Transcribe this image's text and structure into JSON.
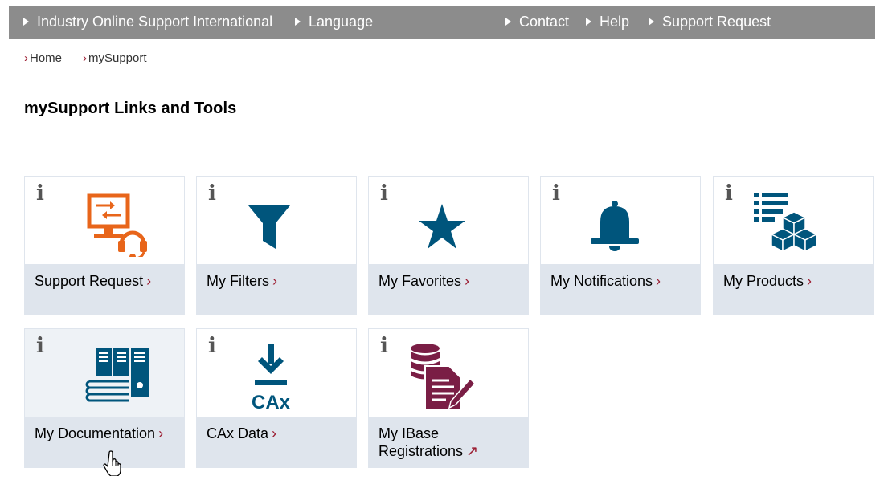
{
  "topbar": {
    "left_links": [
      "Industry Online Support International",
      "Language"
    ],
    "right_links": [
      "Contact",
      "Help",
      "Support Request"
    ],
    "background": "#8c8c8c"
  },
  "breadcrumb": [
    "Home",
    "mySupport"
  ],
  "page_title": "mySupport Links and Tools",
  "tiles": [
    {
      "label": "Support Request",
      "arrow": "›",
      "icon": "monitor-headset-icon",
      "info": "i"
    },
    {
      "label": "My Filters",
      "arrow": "›",
      "icon": "filter-icon",
      "info": "i"
    },
    {
      "label": "My Favorites",
      "arrow": "›",
      "icon": "star-icon",
      "info": "i"
    },
    {
      "label": "My Notifications",
      "arrow": "›",
      "icon": "bell-icon",
      "info": "i"
    },
    {
      "label": "My Products",
      "arrow": "›",
      "icon": "product-cubes-icon",
      "info": "i"
    },
    {
      "label": "My Documentation",
      "arrow": "›",
      "icon": "documentation-binders-icon",
      "info": "i"
    },
    {
      "label": "CAx Data",
      "arrow": "›",
      "icon": "cax-download-icon",
      "info": "i",
      "icon_text": "CAx"
    },
    {
      "label": "My IBase Registrations",
      "arrow": "↗",
      "icon": "ibase-database-document-icon",
      "info": "i"
    }
  ],
  "colors": {
    "accent_red": "#9b1b30",
    "orange_icon": "#e8651a",
    "blue_icon": "#00557c",
    "purple_icon": "#7a1e45",
    "label_bg": "#dfe5ed"
  }
}
